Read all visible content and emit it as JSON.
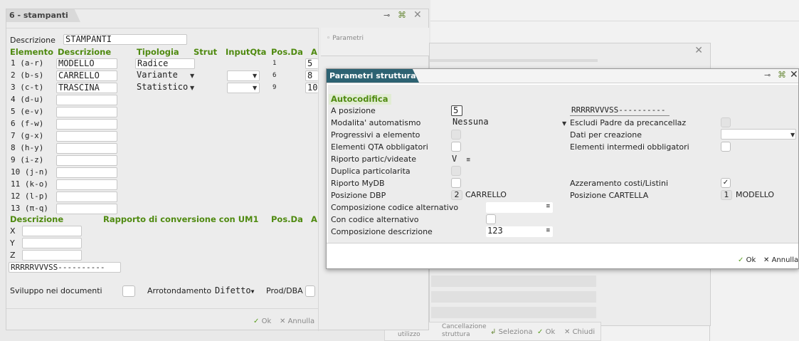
{
  "main_window": {
    "tab_title": "6 - stampanti",
    "descrizione_label": "Descrizione",
    "descrizione_value": "STAMPANTI",
    "columns": [
      "Elemento",
      "Descrizione",
      "Tipologia",
      "Strut",
      "InputQta",
      "Pos.Da",
      "A"
    ],
    "rows": [
      {
        "elemento": "1 (a-r)",
        "descrizione": "MODELLO",
        "tipologia": "Radice",
        "pos": "1",
        "a": "5"
      },
      {
        "elemento": "2 (b-s)",
        "descrizione": "CARRELLO",
        "tipologia": "Variante",
        "pos": "6",
        "a": "8"
      },
      {
        "elemento": "3 (c-t)",
        "descrizione": "TRASCINA",
        "tipologia": "Statistico",
        "pos": "9",
        "a": "10"
      },
      {
        "elemento": "4 (d-u)",
        "descrizione": "",
        "tipologia": "",
        "pos": "",
        "a": ""
      },
      {
        "elemento": "5 (e-v)",
        "descrizione": "",
        "tipologia": "",
        "pos": "",
        "a": ""
      },
      {
        "elemento": "6 (f-w)",
        "descrizione": "",
        "tipologia": "",
        "pos": "",
        "a": ""
      },
      {
        "elemento": "7 (g-x)",
        "descrizione": "",
        "tipologia": "",
        "pos": "",
        "a": ""
      },
      {
        "elemento": "8 (h-y)",
        "descrizione": "",
        "tipologia": "",
        "pos": "",
        "a": ""
      },
      {
        "elemento": "9 (i-z)",
        "descrizione": "",
        "tipologia": "",
        "pos": "",
        "a": ""
      },
      {
        "elemento": "10 (j-n)",
        "descrizione": "",
        "tipologia": "",
        "pos": "",
        "a": ""
      },
      {
        "elemento": "11 (k-o)",
        "descrizione": "",
        "tipologia": "",
        "pos": "",
        "a": ""
      },
      {
        "elemento": "12 (l-p)",
        "descrizione": "",
        "tipologia": "",
        "pos": "",
        "a": ""
      },
      {
        "elemento": "13 (π-q)",
        "descrizione": "",
        "tipologia": "",
        "pos": "",
        "a": ""
      }
    ],
    "conv_headers": [
      "Descrizione",
      "Rapporto di conversione con UM1",
      "Pos.Da",
      "A"
    ],
    "conv_rows": [
      "X",
      "Y",
      "Z"
    ],
    "pattern": "RRRRRVVVSS----------",
    "sviluppo_label": "Sviluppo nei documenti",
    "arrotondamento_label": "Arrotondamento",
    "arrotondamento_value": "Difetto",
    "prod_dba_label": "Prod/DBA",
    "ok_label": "Ok",
    "annulla_label": "Annulla",
    "parametri_label": "Parametri"
  },
  "bottom_bar": {
    "utilizzo": "utilizzo",
    "cancellazione_1": "Cancellazione",
    "cancellazione_2": "struttura",
    "seleziona": "Seleziona",
    "ok": "Ok",
    "chiudi": "Chiudi"
  },
  "dialog": {
    "title": "Parametri struttura",
    "section": "Autocodifica",
    "a_posizione_label": "A posizione",
    "a_posizione_value": "5",
    "pattern_value": "RRRRRVVVSS----------",
    "modalita_label": "Modalita' automatismo",
    "modalita_value": "Nessuna",
    "escludi_label": "Escludi Padre da precancellaz",
    "progressivi_label": "Progressivi a elemento",
    "dati_label": "Dati per creazione",
    "qta_label": "Elementi QTA obbligatori",
    "intermedi_label": "Elementi intermedi obbligatori",
    "riporto_label": "Riporto partic/videate",
    "riporto_value": "V",
    "duplica_label": "Duplica particolarita",
    "mydb_label": "Riporto MyDB",
    "azzeramento_label": "Azzeramento costi/Listini",
    "dbp_label": "Posizione DBP",
    "dbp_num": "2",
    "dbp_name": "CARRELLO",
    "cartella_label": "Posizione CARTELLA",
    "cartella_num": "1",
    "cartella_name": "MODELLO",
    "comp_alt_label": "Composizione codice alternativo",
    "con_alt_label": "Con codice alternativo",
    "comp_desc_label": "Composizione descrizione",
    "comp_desc_value": "123",
    "ok_label": "Ok",
    "annulla_label": "Annulla"
  }
}
